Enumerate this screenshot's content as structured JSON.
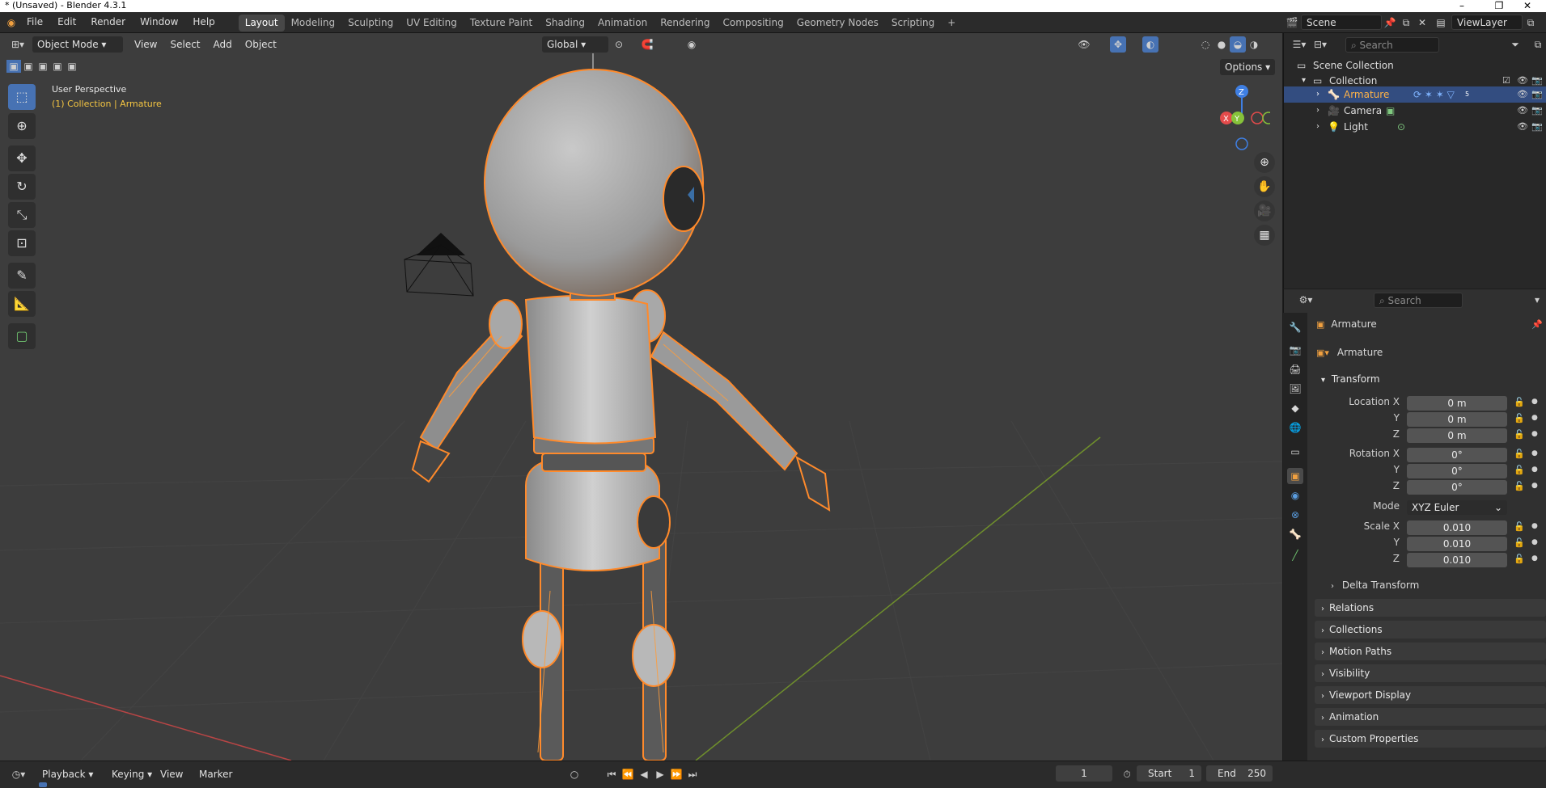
{
  "window": {
    "title": "* (Unsaved) - Blender 4.3.1",
    "minimize": "–",
    "restore": "❐",
    "close": "✕"
  },
  "menu": [
    "File",
    "Edit",
    "Render",
    "Window",
    "Help"
  ],
  "workspaces": [
    "Layout",
    "Modeling",
    "Sculpting",
    "UV Editing",
    "Texture Paint",
    "Shading",
    "Animation",
    "Rendering",
    "Compositing",
    "Geometry Nodes",
    "Scripting"
  ],
  "active_workspace": "Layout",
  "add_workspace": "+",
  "scene": {
    "label": "Scene",
    "view_layer": "ViewLayer"
  },
  "viewport_header": {
    "mode": "Object Mode",
    "menus": [
      "View",
      "Select",
      "Add",
      "Object"
    ],
    "orientation": "Global",
    "options": "Options"
  },
  "viewport": {
    "perspective": "User Perspective",
    "collection_info": "(1) Collection | Armature",
    "gizmo": {
      "z": "Z",
      "y": "Y",
      "x": "X"
    }
  },
  "outliner": {
    "search_placeholder": "Search",
    "scene_collection": "Scene Collection",
    "collection": "Collection",
    "items": [
      {
        "name": "Armature",
        "selected": true,
        "badge": "5"
      },
      {
        "name": "Camera",
        "selected": false
      },
      {
        "name": "Light",
        "selected": false
      }
    ]
  },
  "properties": {
    "search_placeholder": "Search",
    "object_name": "Armature",
    "datablock_name": "Armature",
    "transform_label": "Transform",
    "location": {
      "label_x": "Location X",
      "label_y": "Y",
      "label_z": "Z",
      "x": "0 m",
      "y": "0 m",
      "z": "0 m"
    },
    "rotation": {
      "label_x": "Rotation X",
      "label_y": "Y",
      "label_z": "Z",
      "x": "0°",
      "y": "0°",
      "z": "0°"
    },
    "mode": {
      "label": "Mode",
      "value": "XYZ Euler"
    },
    "scale": {
      "label_x": "Scale X",
      "label_y": "Y",
      "label_z": "Z",
      "x": "0.010",
      "y": "0.010",
      "z": "0.010"
    },
    "delta_transform": "Delta Transform",
    "panels": [
      "Relations",
      "Collections",
      "Motion Paths",
      "Visibility",
      "Viewport Display",
      "Animation",
      "Custom Properties"
    ]
  },
  "timeline": {
    "menus": [
      "Playback",
      "Keying",
      "View",
      "Marker"
    ],
    "current_frame": "1",
    "start_label": "Start",
    "start": "1",
    "end_label": "End",
    "end": "250"
  },
  "colors": {
    "accent": "#4772b3",
    "selection_outline": "#ff8a2b",
    "x_axis": "#e34b4b",
    "y_axis": "#86c23a",
    "z_axis": "#3f7fe3"
  }
}
